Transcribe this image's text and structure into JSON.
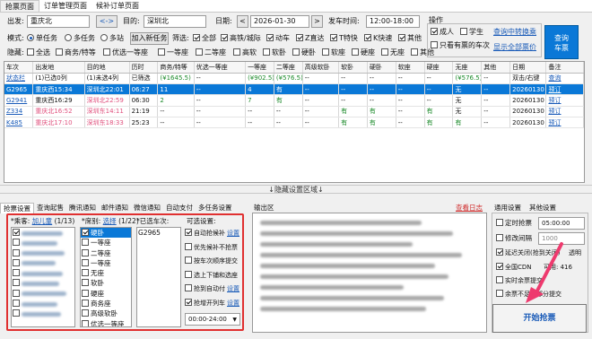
{
  "tabs": [
    "抢票页面",
    "订单管理页面",
    "候补订单页面"
  ],
  "search": {
    "from_label": "出发:",
    "from_value": "重庆北",
    "swap_icon": "<->",
    "to_label": "目的:",
    "to_value": "深圳北",
    "date_label": "日期:",
    "date_prev": "<",
    "date_value": "2026-01-30",
    "date_next": ">",
    "time_label": "发车时间:",
    "time_value": "12:00-18:00",
    "mode_label": "模式:",
    "mode_single": "单任务",
    "mode_multi": "多任务",
    "mode_multistation": "多站",
    "add_task": "加入新任务",
    "filter_label": "筛选:",
    "filter_all": "全部",
    "filter_gc": "高铁/城际",
    "filter_d": "动车",
    "filter_z": "Z直达",
    "filter_t": "T特快",
    "filter_k": "K快速",
    "filter_other": "其他",
    "hide_label": "隐藏:",
    "hide_opts": [
      "全选",
      "商务/特等",
      "优选一等座",
      "一等座",
      "二等座",
      "高软",
      "软卧",
      "硬卧",
      "软座",
      "硬座",
      "无座",
      "其他"
    ]
  },
  "ops": {
    "title": "操作",
    "adult": "成人",
    "student": "学生",
    "only_seats": "只看有票的车次",
    "transfer_link": "查询中转换乘",
    "price_link": "显示全部票价",
    "query_btn": "查询\n车票"
  },
  "table": {
    "headers": [
      "车次",
      "出发地",
      "目的地",
      "历时",
      "商务/特等",
      "优选一等座",
      "一等座",
      "二等座",
      "高级软卧",
      "软卧",
      "硬卧",
      "软座",
      "硬座",
      "无座",
      "其他",
      "日期",
      "备注"
    ],
    "rows": [
      [
        "状态栏",
        "(1)已选0列",
        "(1)未选4列",
        "已筛选",
        "(¥1645.5)",
        "--",
        "(¥902.5)",
        "(¥576.5)",
        "--",
        "--",
        "--",
        "--",
        "--",
        "(¥576.5)",
        "--",
        "双击/右键",
        "查询"
      ],
      [
        "G2965",
        "重庆西15:34",
        "深圳北22:01",
        "06:27",
        "11",
        "--",
        "4",
        "有",
        "--",
        "--",
        "--",
        "--",
        "--",
        "无",
        "--",
        "20260130",
        "预订"
      ],
      [
        "G2941",
        "重庆西16:29",
        "深圳北22:59",
        "06:30",
        "2",
        "--",
        "7",
        "有",
        "--",
        "--",
        "--",
        "--",
        "--",
        "无",
        "--",
        "20260130",
        "预订"
      ],
      [
        "Z334",
        "重庆北16:52",
        "深圳东14:11",
        "21:19",
        "--",
        "--",
        "--",
        "--",
        "--",
        "有",
        "有",
        "--",
        "有",
        "无",
        "--",
        "20260130",
        "预订"
      ],
      [
        "K485",
        "重庆北17:10",
        "深圳东18:33",
        "25:23",
        "--",
        "--",
        "--",
        "--",
        "--",
        "有",
        "有",
        "--",
        "有",
        "有",
        "--",
        "20260130",
        "预订"
      ]
    ]
  },
  "splitter": "↓隐藏设置区域↓",
  "bottom_tabs": [
    "抢票设置",
    "查询起售",
    "腾讯通知",
    "邮件通知",
    "微信通知",
    "自动支付",
    "多任务设置"
  ],
  "passenger_label": "*乘客:",
  "passenger_link": "加儿童",
  "passenger_count": "(1/13)",
  "seat_label": "*席别:",
  "seat_link": "选择",
  "seat_count": "(1/22)",
  "selected_trains_label": "*已选车次:",
  "selected_trains": [
    "G2965"
  ],
  "seats": [
    "硬卧",
    "一等座",
    "二等座",
    "一等座",
    "无座",
    "软卧",
    "硬座",
    "商务座",
    "高级软卧",
    "优选一等座"
  ],
  "options_title": "可选设置:",
  "options": [
    {
      "label": "自动抢候补",
      "link": "设置",
      "checked": true
    },
    {
      "label": "优先候补不抢票",
      "link": "",
      "checked": false
    },
    {
      "label": "按车次顺序提交",
      "link": "",
      "checked": false
    },
    {
      "label": "选上下铺和选座",
      "link": "",
      "checked": false
    },
    {
      "label": "抢到自动付",
      "link": "设置",
      "checked": false
    },
    {
      "label": "抢增开列车",
      "link": "设置",
      "checked": true
    }
  ],
  "time_range": "00:00-24:00",
  "log": {
    "title": "输出区",
    "clear": "查看日志"
  },
  "general": {
    "tab1": "通用设置",
    "tab2": "其他设置",
    "timer": "定时抢票",
    "timer_time": "05:00:00",
    "interval": "修改间隔",
    "interval_val": "1000",
    "delay": "延迟关闭",
    "delay_rest": "(抢到关闭)",
    "transparent": "透明",
    "cdn": "全国CDN",
    "cdn_status": "可用:",
    "cdn_count": "416",
    "realname": "实时余票提交",
    "supplement": "余票不足抢部分提交",
    "start": "开始抢票"
  }
}
